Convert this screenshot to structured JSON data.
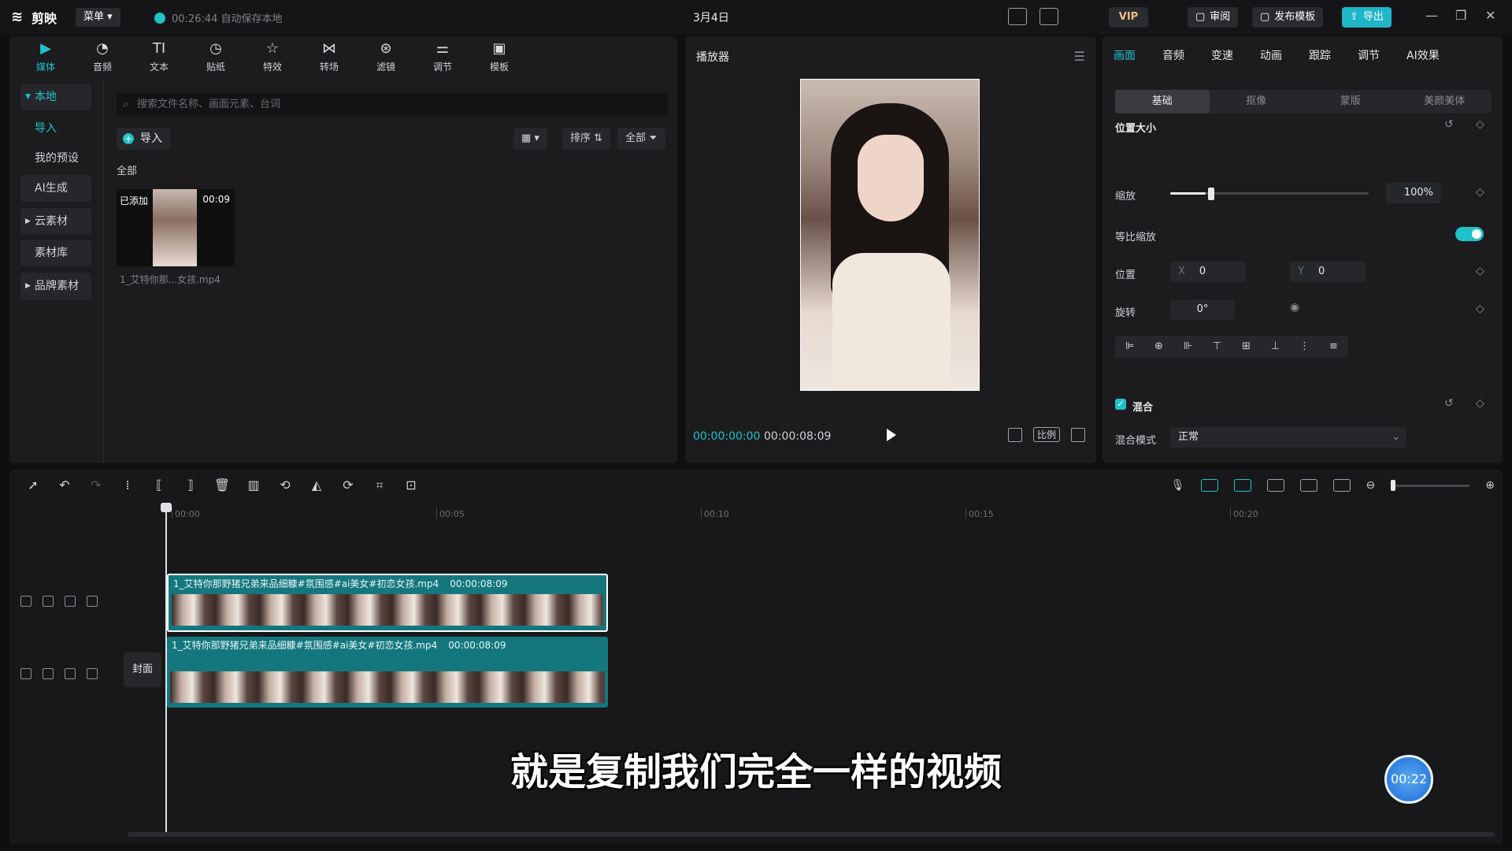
{
  "titlebar": {
    "app_name": "剪映",
    "menu_label": "菜单",
    "save_status": "00:26:44 自动保存本地",
    "doc_title": "3月4日",
    "vip_label": "VIP",
    "review_label": "审阅",
    "publish_label": "发布模板",
    "export_label": "导出"
  },
  "media_tabs": [
    {
      "label": "媒体",
      "icon": "media-icon"
    },
    {
      "label": "音频",
      "icon": "audio-icon"
    },
    {
      "label": "文本",
      "icon": "text-icon"
    },
    {
      "label": "贴纸",
      "icon": "sticker-icon"
    },
    {
      "label": "特效",
      "icon": "effects-icon"
    },
    {
      "label": "转场",
      "icon": "transition-icon"
    },
    {
      "label": "滤镜",
      "icon": "filter-icon"
    },
    {
      "label": "调节",
      "icon": "adjust-icon"
    },
    {
      "label": "模板",
      "icon": "template-icon"
    }
  ],
  "media_side": {
    "local": "本地",
    "import": "导入",
    "my_presets": "我的预设",
    "ai_generate": "AI生成",
    "cloud": "云素材",
    "library": "素材库",
    "brand": "品牌素材"
  },
  "media": {
    "search_placeholder": "搜索文件名称、画面元素、台词",
    "import_label": "导入",
    "sort_label": "排序",
    "filter_label": "全部",
    "all_label": "全部",
    "item_badge": "已添加",
    "item_duration": "00:09",
    "item_name": "1_艾特你那...女孩.mp4"
  },
  "player": {
    "title": "播放器",
    "time_current": "00:00:00:00",
    "time_total": "00:00:08:09",
    "ratio_label": "比例"
  },
  "inspector": {
    "tabs": [
      "画面",
      "音频",
      "变速",
      "动画",
      "跟踪",
      "调节",
      "AI效果"
    ],
    "sub_tabs": [
      "基础",
      "抠像",
      "蒙版",
      "美颜美体"
    ],
    "section_position": "位置大小",
    "scale_label": "缩放",
    "scale_value": "100%",
    "scale_fraction": 0.18,
    "uniform_scale_label": "等比缩放",
    "position_label": "位置",
    "pos_x_key": "X",
    "pos_x": "0",
    "pos_y_key": "Y",
    "pos_y": "0",
    "rotation_label": "旋转",
    "rotation_value": "0°",
    "blend_section": "混合",
    "blend_mode_label": "混合模式",
    "blend_mode_value": "正常"
  },
  "timeline": {
    "ruler_ticks": [
      "00:00",
      "00:05",
      "00:10",
      "00:15",
      "00:20"
    ],
    "cover_label": "封面",
    "clip1_name": "1_艾特你那野猪兄弟来品细糠#氛围感#ai美女#初恋女孩.mp4",
    "clip1_duration": "00:00:08:09",
    "clip2_name": "1_艾特你那野猪兄弟来品细糠#氛围感#ai美女#初恋女孩.mp4",
    "clip2_duration": "00:00:08:09"
  },
  "overlay": {
    "subtitle": "就是复制我们完全一样的视频",
    "rec_time": "00:22"
  },
  "colors": {
    "accent": "#1fc2c9",
    "clip_teal": "#15777e",
    "bg": "#0f0f10",
    "panel": "#1c1c1f"
  }
}
